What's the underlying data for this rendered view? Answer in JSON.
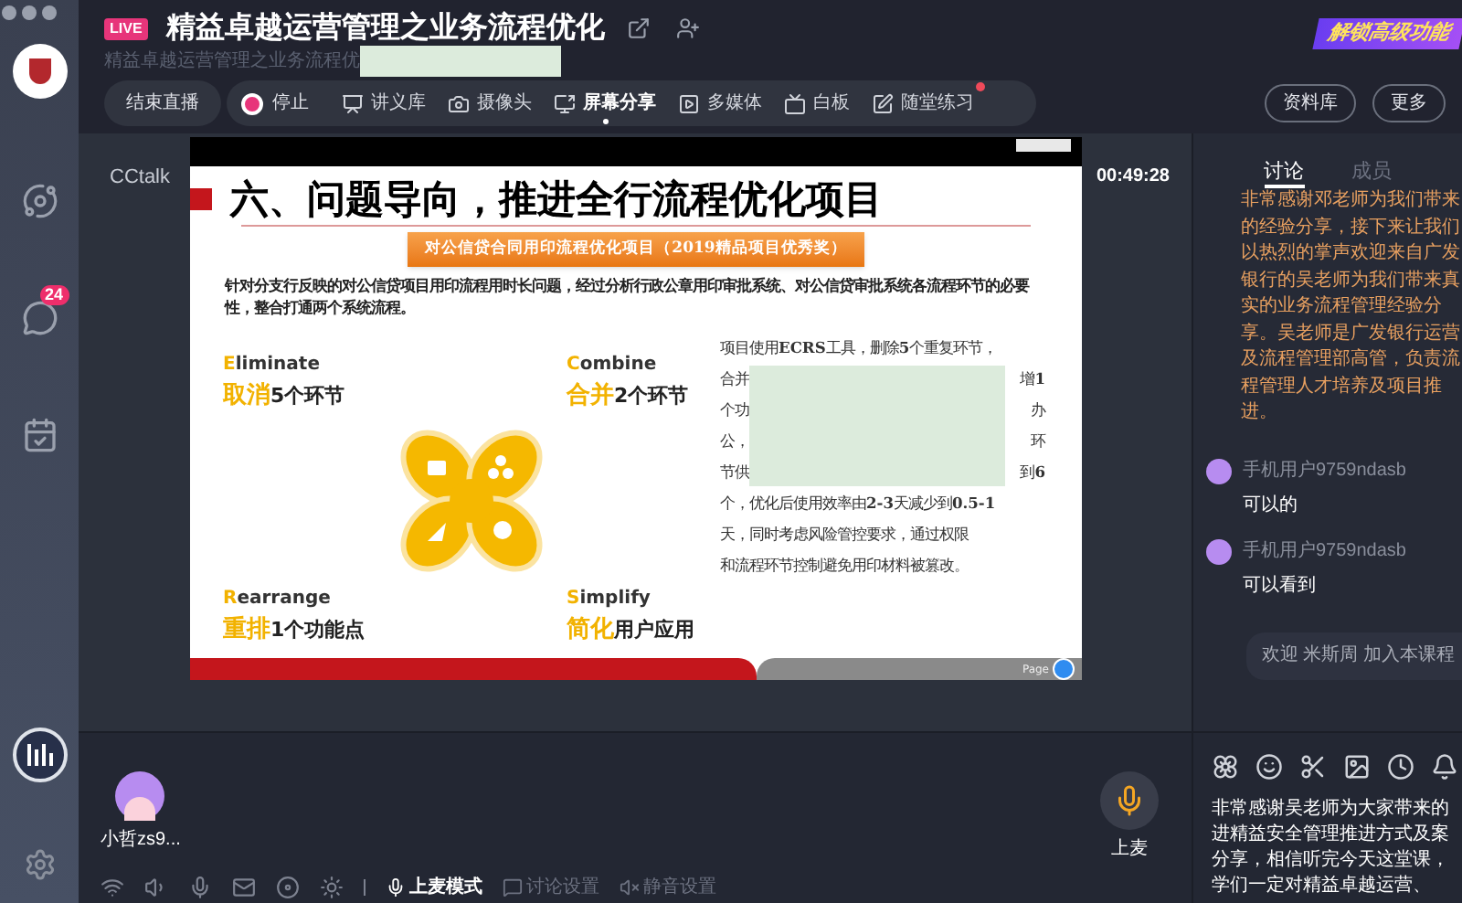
{
  "sidebar": {
    "items": [
      {
        "kind": "explore"
      },
      {
        "kind": "chat",
        "badge": "24"
      },
      {
        "kind": "tasks"
      }
    ]
  },
  "header": {
    "live_badge": "LIVE",
    "title": "精益卓越运营管理之业务流程优化",
    "subtitle": "精益卓越运营管理之业务流程优",
    "promo": "解锁高级功能"
  },
  "toolbar": {
    "end_button": "结束直播",
    "stop_button": "停止",
    "items": [
      {
        "kind": "handouts",
        "label": "讲义库",
        "selected": false,
        "notice": false
      },
      {
        "kind": "camera",
        "label": "摄像头",
        "selected": false,
        "notice": false
      },
      {
        "kind": "screen",
        "label": "屏幕分享",
        "selected": true,
        "notice": false
      },
      {
        "kind": "media",
        "label": "多媒体",
        "selected": false,
        "notice": false
      },
      {
        "kind": "whiteboard",
        "label": "白板",
        "selected": false,
        "notice": false
      },
      {
        "kind": "exercise",
        "label": "随堂练习",
        "selected": false,
        "notice": true
      }
    ],
    "right_buttons": [
      "资料库",
      "更多"
    ]
  },
  "stage": {
    "brand": "CCtalk",
    "timer": "00:49:28",
    "slide": {
      "title": "六、问题导向，推进全行流程优化项目",
      "banner": "对公信贷合同用印流程优化项目（2019精品项目优秀奖）",
      "intro": "针对分支行反映的对公信贷项目用印流程用时长问题，经过分析行政公章用印审批系统、对公信贷审批系统各流程环节的必要性，整合打通两个系统流程。",
      "quadrants": [
        {
          "letter": "E",
          "word": "liminate",
          "cn": "取消",
          "detail": "5个环节"
        },
        {
          "letter": "C",
          "word": "ombine",
          "cn": "合并",
          "detail": "2个环节"
        },
        {
          "letter": "R",
          "word": "earrange",
          "cn": "重排",
          "detail": "1个功能点"
        },
        {
          "letter": "S",
          "word": "implify",
          "cn": "简化",
          "detail": "用户应用"
        }
      ],
      "lines": [
        {
          "left": "项目使用**ECRS**工具，删除**5**个重复环节，"
        },
        {
          "left": "合并",
          "right": "增**1**"
        },
        {
          "left": "个功",
          "right": "办"
        },
        {
          "left": "公，",
          "right": "环"
        },
        {
          "left": "节供",
          "right": "到**6**"
        },
        {
          "left": "个，优化后使用效率由**2-3**天减少到**0.5-1**"
        },
        {
          "left": "天，同时考虑风险管控要求，通过权限"
        },
        {
          "left": "和流程环节控制避免用印材料被篡改。"
        }
      ],
      "footer": "Page"
    }
  },
  "bottom": {
    "participant": "小哲zs9...",
    "mic_button": "上麦",
    "controls": [
      {
        "kind": "mic",
        "label": "上麦模式",
        "disabled": false
      },
      {
        "kind": "chat",
        "label": "讨论设置",
        "disabled": true
      },
      {
        "kind": "mute",
        "label": "静音设置",
        "disabled": true
      }
    ]
  },
  "chat": {
    "tabs": [
      {
        "label": "讨论",
        "selected": true
      },
      {
        "label": "成员",
        "selected": false
      }
    ],
    "announcement": [
      "非常感谢邓老师为我们带来",
      "的经验分享，接下来让我们",
      "以热烈的掌声欢迎来自广发",
      "银行的吴老师为我们带来真",
      "实的业务流程管理经验分",
      "享。吴老师是广发银行运营",
      "及流程管理部高管，负责流",
      "程管理人才培养及项目推",
      "进。"
    ],
    "messages": [
      {
        "user": "手机用户9759ndasb",
        "text": "可以的"
      },
      {
        "user": "手机用户9759ndasb",
        "text": "可以看到"
      }
    ],
    "notice": "欢迎 米斯周 加入本课程",
    "draft_lines": [
      "非常感谢吴老师为大家带来的",
      "进精益安全管理推进方式及案",
      "分享，相信听完今天这堂课，",
      "学们一定对精益卓越运营、"
    ]
  }
}
